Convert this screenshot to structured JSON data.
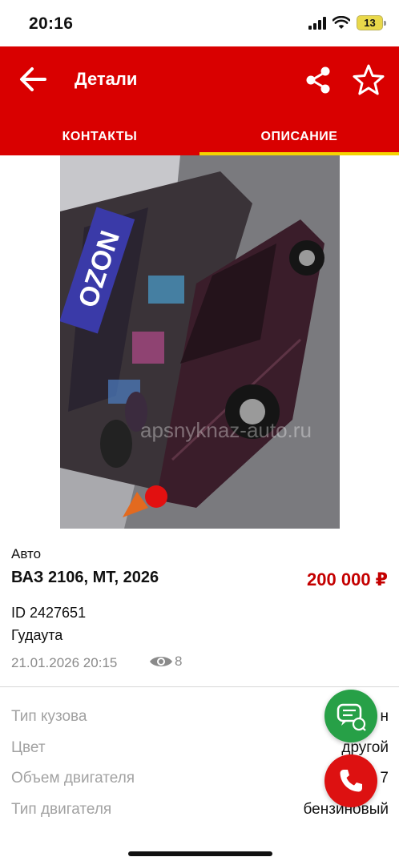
{
  "status_bar": {
    "time": "20:16",
    "battery": "13"
  },
  "header": {
    "title": "Детали",
    "back_icon": "arrow-left-icon",
    "share_icon": "share-icon",
    "favorite_icon": "star-outline-icon"
  },
  "tabs": [
    {
      "label": "КОНТАКТЫ",
      "active": false
    },
    {
      "label": "ОПИСАНИЕ",
      "active": true
    }
  ],
  "photo": {
    "watermark": "apsnyknaz-auto.ru",
    "store_sign": "OZON"
  },
  "listing": {
    "category": "Авто",
    "title": "ВАЗ 2106, МТ, 2026",
    "price": "200 000 ₽",
    "id": "ID 2427651",
    "city": "Гудаута",
    "date": "21.01.2026 20:15",
    "views": "8"
  },
  "specs": [
    {
      "label": "Тип кузова",
      "value": "н"
    },
    {
      "label": "Цвет",
      "value": "другой"
    },
    {
      "label": "Объем двигателя",
      "value": "7"
    },
    {
      "label": "Тип двигателя",
      "value": "бензиновый"
    }
  ],
  "colors": {
    "brand_red": "#d90000",
    "tab_indicator": "#f5d400",
    "price": "#c40000",
    "chat_green": "#27a047",
    "call_red": "#dd1111"
  }
}
